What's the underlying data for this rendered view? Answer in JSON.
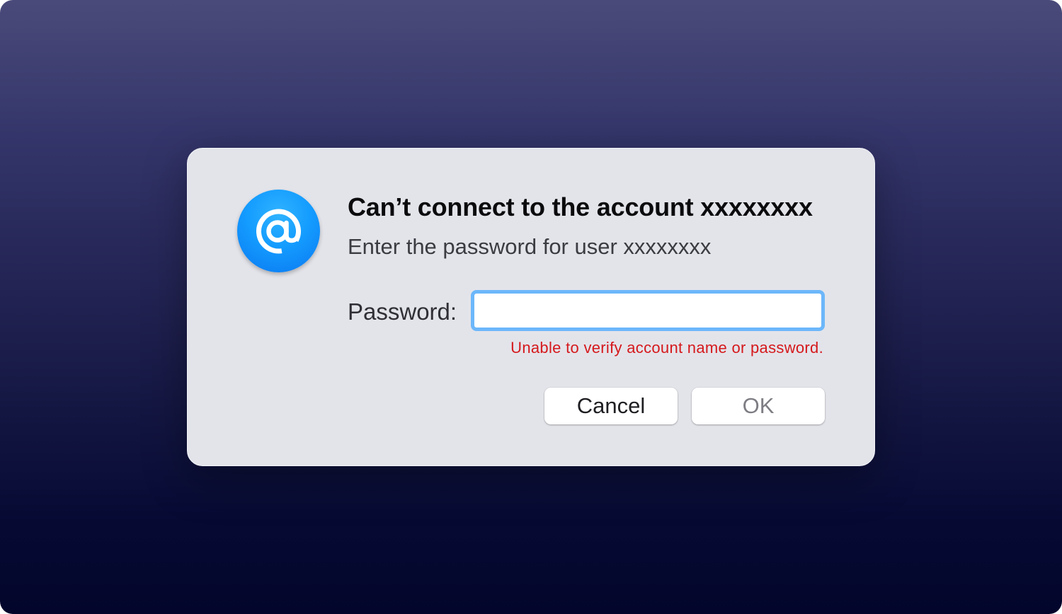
{
  "dialog": {
    "title": "Can’t connect to the account xxxxxxxx",
    "subtitle": "Enter the password for user xxxxxxxx",
    "password_label": "Password:",
    "password_value": "",
    "error_message": "Unable to verify account name or password.",
    "cancel_label": "Cancel",
    "ok_label": "OK",
    "icon": "at-sign-icon"
  },
  "colors": {
    "accent": "#6cb7fa",
    "error": "#d5191c",
    "icon_blue": "#149cff"
  }
}
